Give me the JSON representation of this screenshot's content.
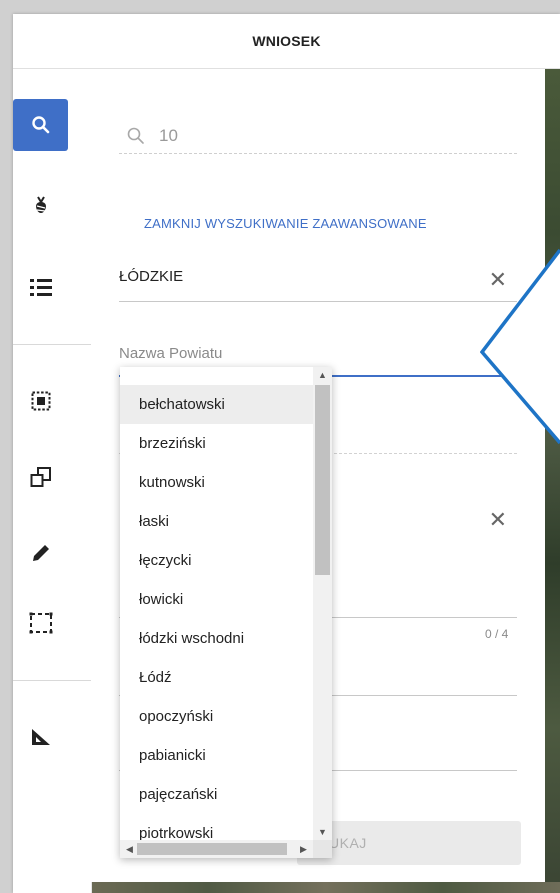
{
  "window": {
    "title": "WNIOSEK"
  },
  "toolbar": {
    "icons": [
      "search-icon",
      "plant-icon",
      "list-icon",
      "select-area-icon",
      "copy-shape-icon",
      "pencil-icon",
      "dashed-rect-icon",
      "ruler-triangle-icon"
    ]
  },
  "search": {
    "value": "10"
  },
  "advanced": {
    "close_label": "ZAMKNIJ WYSZUKIWANIE ZAAWANSOWANE"
  },
  "voivodeship": {
    "value": "ŁÓDZKIE",
    "clear": "✕"
  },
  "county": {
    "placeholder": "Nazwa Powiatu"
  },
  "second_clear": "✕",
  "counter": "0 / 4",
  "search_button": {
    "label": "SZUKAJ",
    "visible_label": "UKAJ"
  },
  "dropdown": {
    "options": [
      "bełchatowski",
      "brzeziński",
      "kutnowski",
      "łaski",
      "łęczycki",
      "łowicki",
      "łódzki wschodni",
      "Łódź",
      "opoczyński",
      "pabianicki",
      "pajęczański",
      "piotrkowski"
    ],
    "highlighted_index": 0
  },
  "colors": {
    "accent": "#3f6fc7",
    "tooltip_border": "#1e74c6"
  }
}
